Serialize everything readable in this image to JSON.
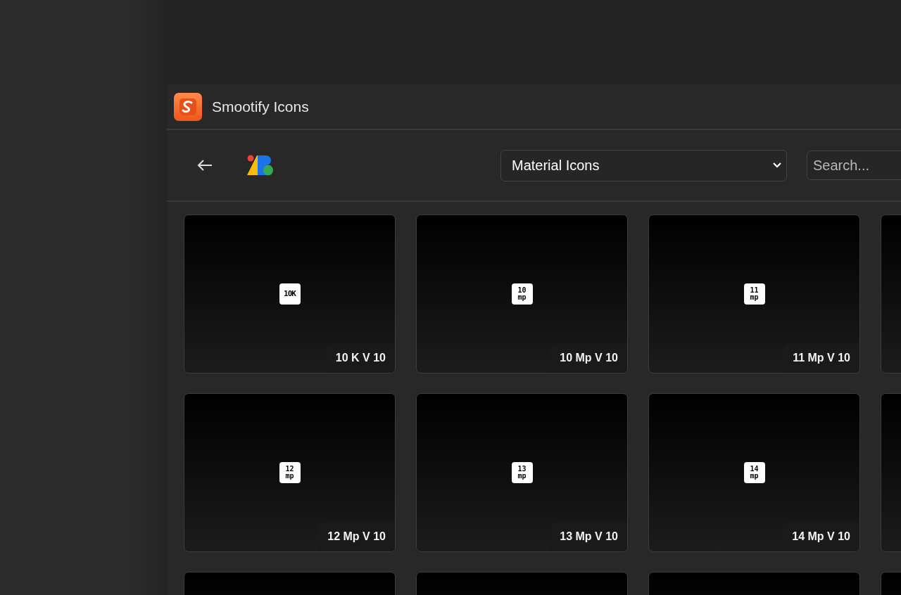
{
  "window": {
    "title": "Smootify Icons"
  },
  "toolbar": {
    "library": "Material Icons",
    "search": {
      "placeholder": "Search..."
    }
  },
  "cards": [
    {
      "kind": "icon",
      "glyph": [
        "10K"
      ],
      "label": "10 K V 10"
    },
    {
      "kind": "icon",
      "glyph": [
        "10",
        "mp"
      ],
      "label": "10 Mp V 10"
    },
    {
      "kind": "icon",
      "glyph": [
        "11",
        "mp"
      ],
      "label": "11 Mp V 10"
    },
    {
      "kind": "cut"
    },
    {
      "kind": "icon",
      "glyph": [
        "12",
        "mp"
      ],
      "label": "12 Mp V 10"
    },
    {
      "kind": "icon",
      "glyph": [
        "13",
        "mp"
      ],
      "label": "13 Mp V 10"
    },
    {
      "kind": "icon",
      "glyph": [
        "14",
        "mp"
      ],
      "label": "14 Mp V 10"
    },
    {
      "kind": "cut"
    },
    {
      "kind": "cut"
    },
    {
      "kind": "cut"
    },
    {
      "kind": "cut"
    },
    {
      "kind": "cut"
    }
  ]
}
